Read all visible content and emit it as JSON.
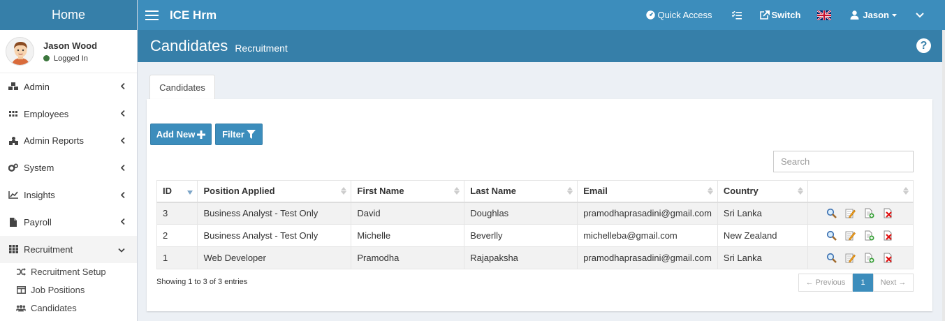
{
  "sidebar": {
    "home_label": "Home",
    "user_name": "Jason Wood",
    "user_status": "Logged In",
    "menu": [
      {
        "label": "Admin",
        "icon": "cubes-icon"
      },
      {
        "label": "Employees",
        "icon": "grid-icon"
      },
      {
        "label": "Admin Reports",
        "icon": "reports-icon"
      },
      {
        "label": "System",
        "icon": "gears-icon"
      },
      {
        "label": "Insights",
        "icon": "line-chart-icon"
      },
      {
        "label": "Payroll",
        "icon": "file-icon"
      },
      {
        "label": "Recruitment",
        "icon": "grid-icon",
        "expanded": true
      }
    ],
    "submenu": [
      {
        "label": "Recruitment Setup",
        "icon": "random-icon"
      },
      {
        "label": "Job Positions",
        "icon": "columns-icon"
      },
      {
        "label": "Candidates",
        "icon": "users-icon"
      }
    ]
  },
  "topnav": {
    "app_name": "ICE Hrm",
    "quick_access": "Quick Access",
    "switch_label": "Switch",
    "user": "Jason"
  },
  "header": {
    "title": "Candidates",
    "subtitle": "Recruitment",
    "help": "?"
  },
  "tab_label": "Candidates",
  "toolbar": {
    "add_new": "Add New",
    "filter": "Filter"
  },
  "search": {
    "placeholder": "Search"
  },
  "table": {
    "columns": [
      "ID",
      "Position Applied",
      "First Name",
      "Last Name",
      "Email",
      "Country",
      ""
    ],
    "rows": [
      [
        "3",
        "Business Analyst - Test Only",
        "David",
        "Doughlas",
        "pramodhaprasadini@gmail.com",
        "Sri Lanka"
      ],
      [
        "2",
        "Business Analyst - Test Only",
        "Michelle",
        "Beverlly",
        "michelleba@gmail.com",
        "New Zealand"
      ],
      [
        "1",
        "Web Developer",
        "Pramodha",
        "Rajapaksha",
        "pramodhaprasadini@gmail.com",
        "Sri Lanka"
      ]
    ]
  },
  "footer": {
    "info": "Showing 1 to 3 of 3 entries",
    "prev": "← Previous",
    "page": "1",
    "next": "Next →"
  },
  "colors": {
    "primary": "#3c8dbc",
    "primary_dark": "#367fa9"
  }
}
